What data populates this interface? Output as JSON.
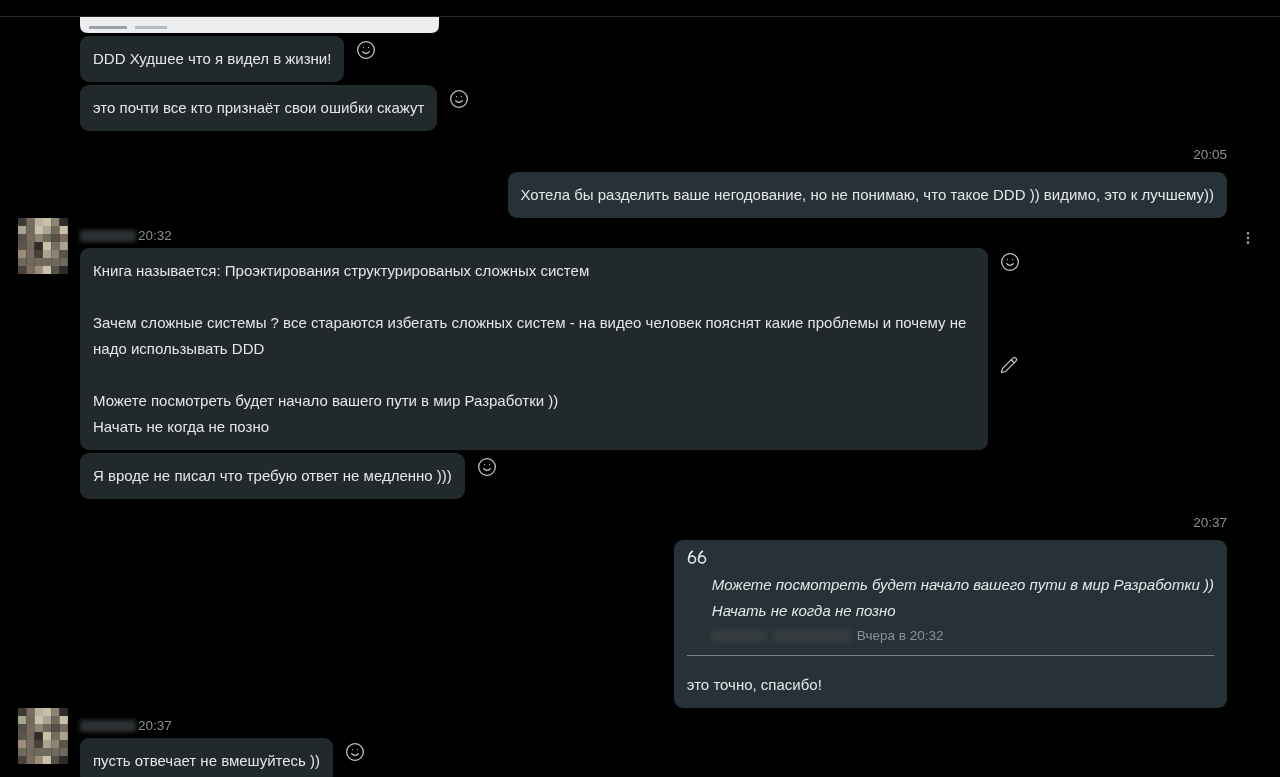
{
  "groups": [
    {
      "kind": "incoming",
      "messages": [
        {
          "paragraphs": [
            "DDD Худшее что я видел в жизни!"
          ]
        },
        {
          "paragraphs": [
            "это почти все кто признаёт свои ошибки скажут"
          ]
        }
      ]
    },
    {
      "kind": "outgoing",
      "time": "20:05",
      "messages": [
        {
          "paragraphs": [
            "Хотела бы разделить ваше негодование, но не понимаю, что такое DDD )) видимо, это к лучшему))"
          ]
        }
      ]
    },
    {
      "kind": "incoming",
      "time": "20:32",
      "menu": true,
      "messages": [
        {
          "paragraphs": [
            "Книга называется: Проэктирования структурированых сложных систем",
            "Зачем сложные системы ? все стараются избегать сложных систем - на видео человек пояснят какие проблемы и почему не надо использывать DDD",
            "Можете посмотреть будет начало вашего пути в мир Разработки ))\nНачать не когда не позно"
          ],
          "edit": true
        },
        {
          "paragraphs": [
            "Я вроде не писал что требую ответ не медленно )))"
          ]
        }
      ]
    },
    {
      "kind": "outgoing",
      "time": "20:37",
      "messages": [
        {
          "quote": {
            "lines": [
              "Можете посмотреть будет начало вашего пути в мир Разработки ))",
              "Начать не когда не позно"
            ],
            "meta": "Вчера в 20:32"
          },
          "paragraphs": [
            "это точно, спасибо!"
          ]
        }
      ]
    },
    {
      "kind": "incoming",
      "time": "20:37",
      "messages": [
        {
          "paragraphs": [
            "пусть отвечает не вмешуйтесь ))"
          ]
        }
      ]
    }
  ]
}
